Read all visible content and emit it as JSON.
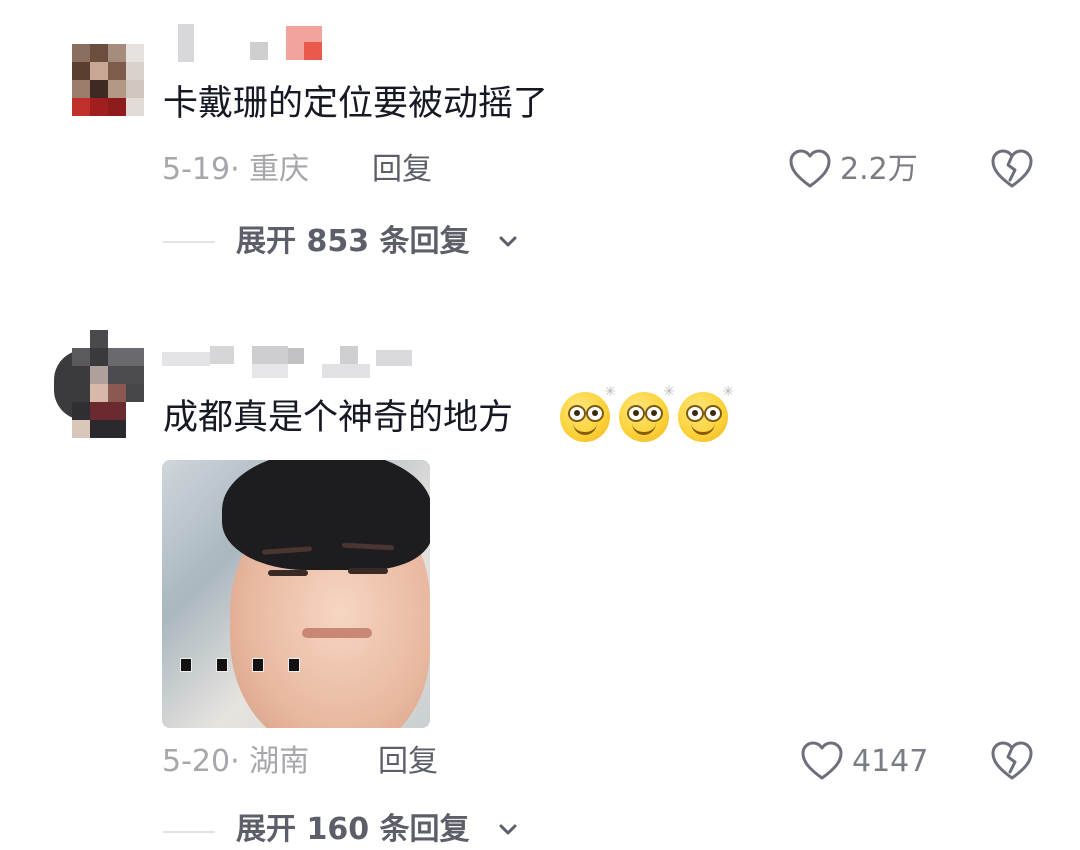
{
  "comments": [
    {
      "text": "卡戴珊的定位要被动摇了",
      "date_location": "5-19· 重庆",
      "reply_label": "回复",
      "like_count": "2.2万",
      "expand_label": "展开 853 条回复"
    },
    {
      "text": "成都真是个神奇的地方",
      "emoji_count": 3,
      "has_image": true,
      "date_location": "5-20· 湖南",
      "reply_label": "回复",
      "like_count": "4147",
      "expand_label": "展开 160 条回复"
    }
  ],
  "icons": {
    "like": "heart-outline-icon",
    "dislike": "broken-heart-icon",
    "expand": "chevron-down-icon",
    "emoji": "dizzy-eyes-smile-emoji"
  },
  "colors": {
    "text_primary": "#161823",
    "text_meta": "#a6a6ab",
    "text_secondary": "#5c5f69",
    "background": "#ffffff"
  }
}
